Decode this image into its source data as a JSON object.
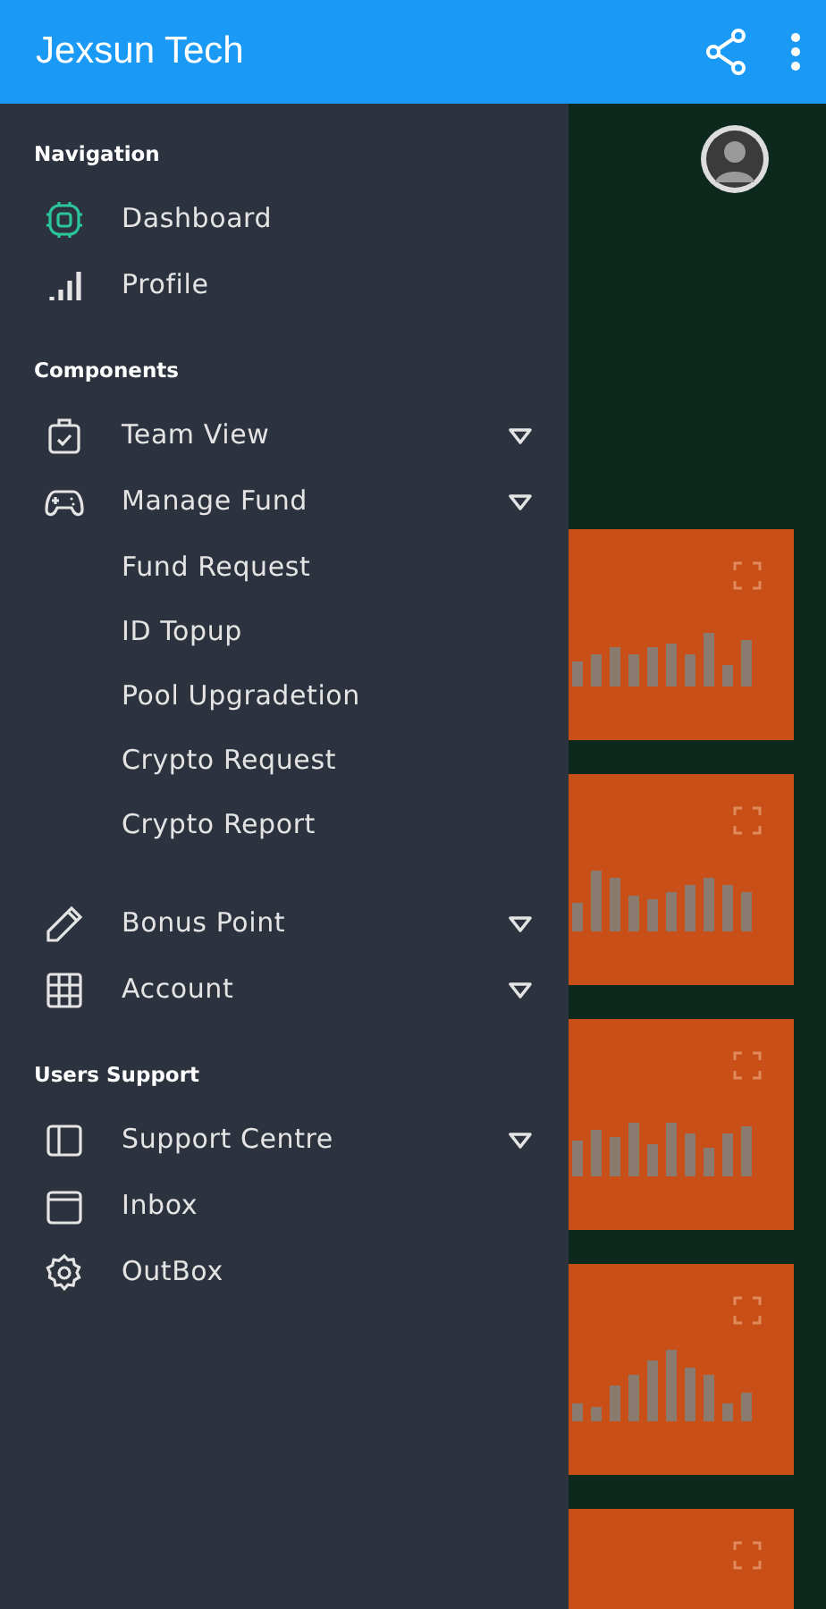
{
  "app_bar": {
    "title": "Jexsun Tech"
  },
  "drawer": {
    "sections": [
      {
        "title": "Navigation",
        "items": [
          {
            "label": "Dashboard",
            "kind": "link",
            "selected": true
          },
          {
            "label": "Profile",
            "kind": "link",
            "selected": false
          }
        ]
      },
      {
        "title": "Components",
        "items": [
          {
            "label": "Team View",
            "kind": "group",
            "selected": false
          },
          {
            "label": "Manage Fund",
            "kind": "group",
            "selected": false,
            "children": [
              {
                "label": "Fund Request"
              },
              {
                "label": "ID Topup"
              },
              {
                "label": "Pool Upgradetion"
              },
              {
                "label": "Crypto Request"
              },
              {
                "label": "Crypto Report"
              }
            ]
          },
          {
            "label": "Bonus Point",
            "kind": "group",
            "selected": false
          },
          {
            "label": "Account",
            "kind": "group",
            "selected": false
          }
        ]
      },
      {
        "title": "Users Support",
        "items": [
          {
            "label": "Support Centre",
            "kind": "group",
            "selected": false
          },
          {
            "label": "Inbox",
            "kind": "link",
            "selected": false
          },
          {
            "label": "OutBox",
            "kind": "link",
            "selected": false
          }
        ]
      }
    ]
  }
}
